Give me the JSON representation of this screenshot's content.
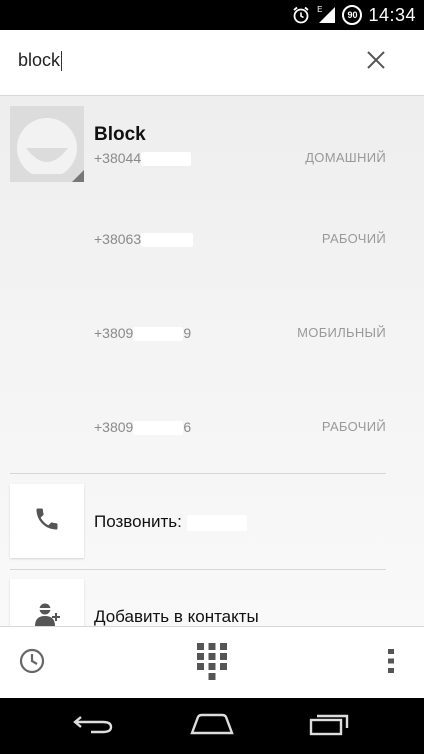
{
  "status_bar": {
    "time": "14:34",
    "network_label": "E",
    "battery_level": "90"
  },
  "search": {
    "query": "block"
  },
  "contact": {
    "name": "Block",
    "phones": [
      {
        "prefix": "+38044",
        "suffix": "",
        "type": "ДОМАШНИЙ"
      },
      {
        "prefix": "+38063",
        "suffix": "",
        "type": "РАБОЧИЙ"
      },
      {
        "prefix": "+3809",
        "suffix": "9",
        "type": "МОБИЛЬНЫЙ"
      },
      {
        "prefix": "+3809",
        "suffix": "6",
        "type": "РАБОЧИЙ"
      }
    ]
  },
  "actions": {
    "call_label": "Позвонить:",
    "add_contact_label": "Добавить в контакты"
  },
  "icons": {
    "alarm": "alarm-icon",
    "signal": "signal-icon",
    "battery": "battery-icon",
    "clear": "close-icon",
    "phone": "phone-icon",
    "add_person": "add-person-icon",
    "history": "clock-icon",
    "dialpad": "dialpad-icon",
    "overflow": "overflow-menu-icon",
    "back": "back-icon",
    "home": "home-icon",
    "recents": "recents-icon"
  },
  "colors": {
    "status_bar_bg": "#000000",
    "nav_bar_bg": "#000000",
    "list_bg": "#f0f0f0",
    "accent_icon": "#555555"
  }
}
